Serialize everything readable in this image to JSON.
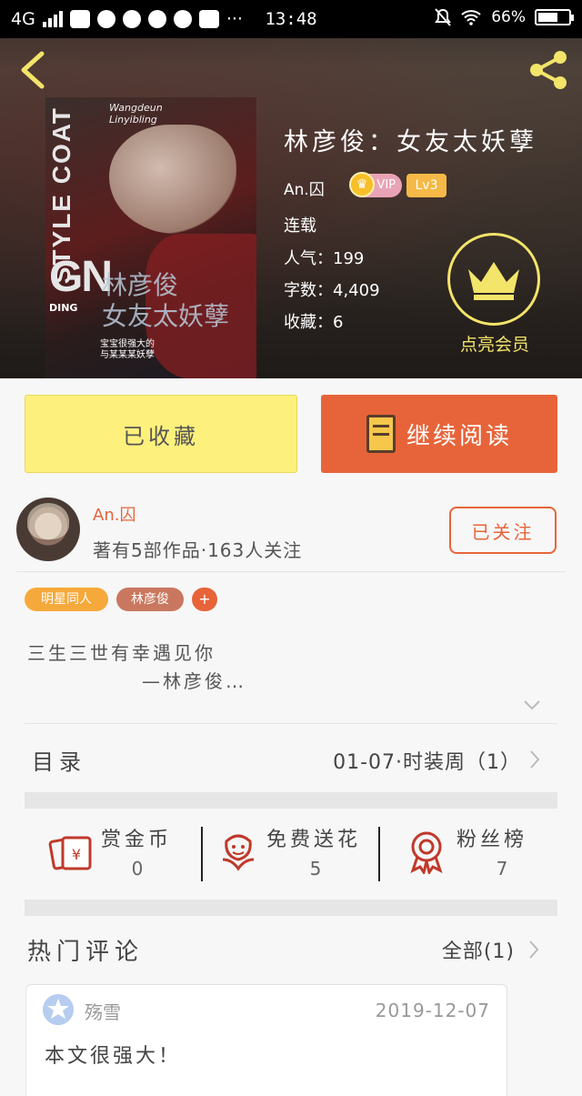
{
  "status_bar": {
    "network": "4G",
    "time": "13:48",
    "battery": "66%",
    "battery_level": 0.66
  },
  "book": {
    "title": "林彦俊：女友太妖孽",
    "author": "An.囚",
    "vip_label": "VIP",
    "level": "Lv3",
    "status": "连载",
    "popularity": "人气：199",
    "word_count": "字数：4,409",
    "collections": "收藏：6",
    "cover": {
      "big_text": "GN",
      "vertical_text": "STYLE COAT",
      "overlay_title": "林彦俊\n女友太妖孽",
      "signature": "Wangdeun\nLinyibling",
      "side_text": "DING",
      "small_text": "宝宝很强大的\n与某某某妖孽"
    }
  },
  "member": {
    "label": "点亮会员"
  },
  "actions": {
    "favorite_label": "已收藏",
    "read_label": "继续阅读"
  },
  "author_section": {
    "name": "An.囚",
    "description": "著有5部作品·163人关注",
    "follow_label": "已关注"
  },
  "tags": [
    "明星同人",
    "林彦俊",
    "+"
  ],
  "intro": {
    "line1": "三生三世有幸遇见你",
    "line2": "—林彦俊…"
  },
  "toc": {
    "label": "目录",
    "latest": "01-07·时装周（1）"
  },
  "stats": [
    {
      "name": "赏金币",
      "value": "0"
    },
    {
      "name": "免费送花",
      "value": "5"
    },
    {
      "name": "粉丝榜",
      "value": "7"
    }
  ],
  "comments_section": {
    "title": "热门评论",
    "all_label": "全部(1)"
  },
  "comments": [
    {
      "user": "殇雪",
      "date": "2019-12-07",
      "text": "本文很强大！"
    }
  ],
  "colors": {
    "accent": "#e7643a",
    "favorite_bg": "#fdf07c",
    "member_gold": "#f3e46a"
  }
}
